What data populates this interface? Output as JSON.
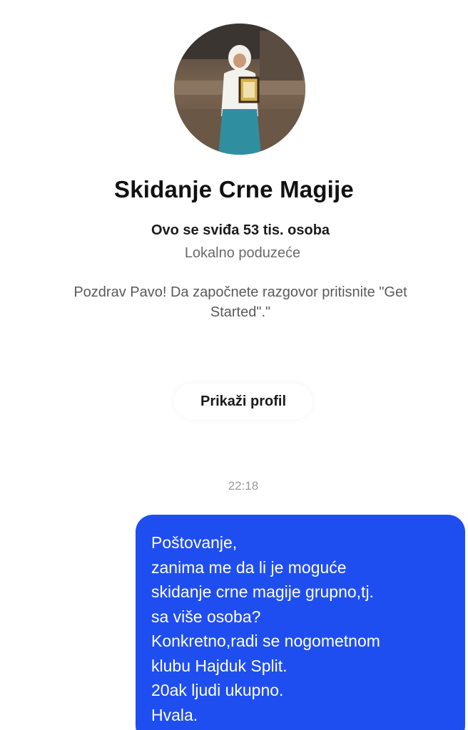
{
  "profile": {
    "avatar_alt": "profile photo",
    "name": "Skidanje Crne Magije",
    "likes": "Ovo se sviđa 53 tis. osoba",
    "category": "Lokalno poduzeće",
    "greeting_line1": "Pozdrav Pavo! Da započnete razgovor pritisnite \"Get",
    "greeting_line2": "Started\".\"",
    "view_profile_label": "Prikaži profil"
  },
  "conversation": {
    "timestamp": "22:18",
    "message_lines": [
      "Poštovanje,",
      "zanima me da li je moguće",
      "skidanje crne magije grupno,tj.",
      "sa više osoba?",
      "Konkretno,radi se nogometnom",
      "klubu Hajduk Split.",
      "20ak ljudi ukupno.",
      "Hvala."
    ]
  },
  "colors": {
    "bubble": "#1f4ef0",
    "bubble_text": "#ffffff",
    "background": "#ffffff"
  }
}
